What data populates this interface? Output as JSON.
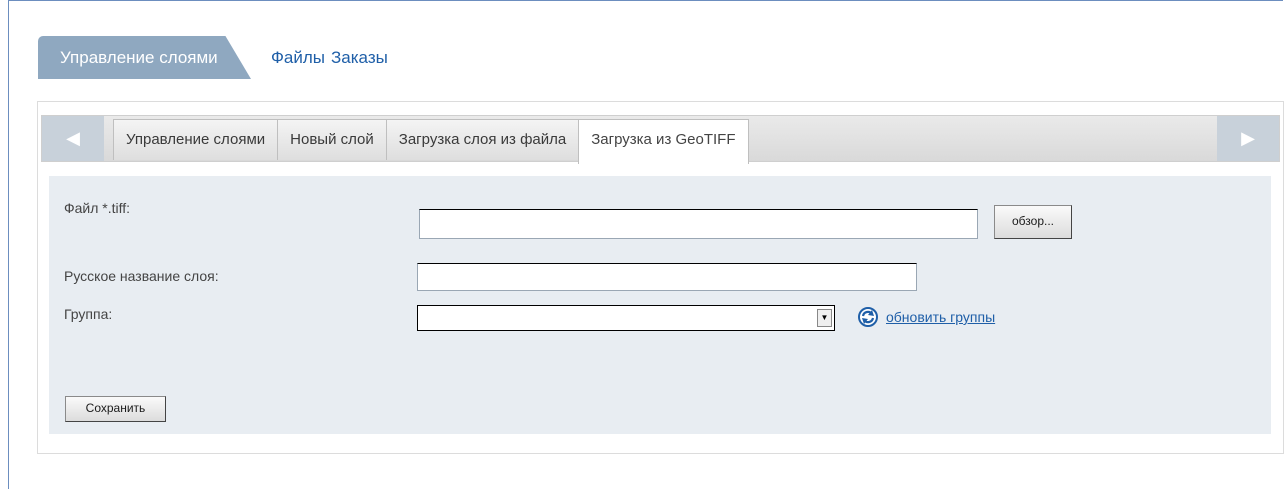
{
  "topnav": {
    "active": "Управление слоями",
    "links": [
      "Файлы",
      "Заказы"
    ]
  },
  "tabs": {
    "items": [
      "Управление слоями",
      "Новый слой",
      "Загрузка слоя из файла",
      "Загрузка из GeoTIFF"
    ],
    "active_index": 3,
    "prev_icon": "◀",
    "next_icon": "▶"
  },
  "form": {
    "file_label": "Файл *.tiff:",
    "file_value": "",
    "browse_label": "обзор...",
    "name_label": "Русское название слоя:",
    "name_value": "",
    "group_label": "Группа:",
    "group_value": "",
    "refresh_label": "обновить группы",
    "save_label": "Сохранить"
  },
  "colors": {
    "accent": "#8fa8c0",
    "link": "#1f5fa8",
    "form_bg": "#e8edf2"
  }
}
